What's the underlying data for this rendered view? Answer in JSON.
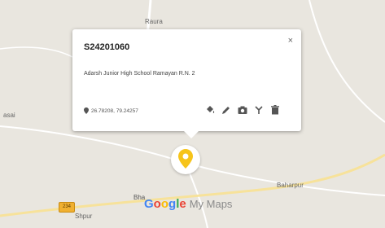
{
  "map": {
    "places": [
      "Raura",
      "asai",
      "Baharpur",
      "Shpur",
      "Bha"
    ],
    "road_badge": "234",
    "brand_google": "Google",
    "brand_maps": "My Maps",
    "brand_colors": [
      "#4285F4",
      "#EA4335",
      "#FBBC05",
      "#4285F4",
      "#34A853",
      "#EA4335"
    ],
    "marker_color": "#f6c41b"
  },
  "info_card": {
    "title": "S24201060",
    "close_label": "×",
    "description": "Adarsh Junior High School Ramayan R.N. 2",
    "coordinates": "26.78208, 79.24257",
    "actions": [
      "paint-bucket-icon",
      "pencil-icon",
      "camera-icon",
      "directions-icon",
      "trash-icon"
    ]
  }
}
